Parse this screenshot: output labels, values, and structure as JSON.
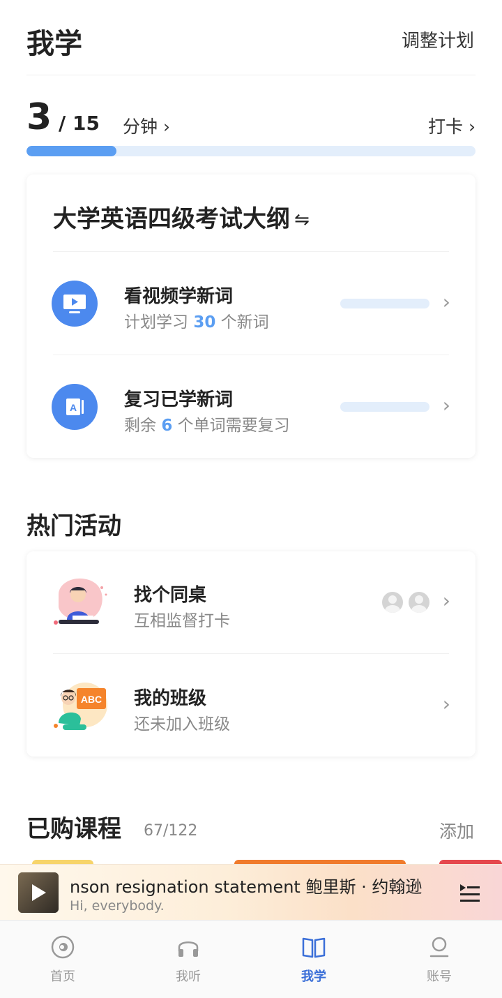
{
  "header": {
    "title": "我学",
    "action_label": "调整计划"
  },
  "progress": {
    "current": "3",
    "total": "/ 15",
    "unit": "分钟 ›",
    "checkin_label": "打卡 ›",
    "fraction": 0.2
  },
  "plan": {
    "title": "大学英语四级考试大纲",
    "swap_icon": "⇋",
    "rows": [
      {
        "title": "看视频学新词",
        "sub_prefix": "计划学习 ",
        "num": "30",
        "sub_suffix": " 个新词",
        "icon": "video-icon"
      },
      {
        "title": "复习已学新词",
        "sub_prefix": "剩余 ",
        "num": "6",
        "sub_suffix": " 个单词需要复习",
        "icon": "word-card-icon"
      }
    ]
  },
  "activities": {
    "title": "热门活动",
    "items": [
      {
        "title": "找个同桌",
        "sub": "互相监督打卡"
      },
      {
        "title": "我的班级",
        "sub": "还未加入班级"
      }
    ]
  },
  "courses": {
    "title": "已购课程",
    "count": "67/122",
    "add_label": "添加"
  },
  "player": {
    "title": "nson resignation statement   鲍里斯 · 约翰逊",
    "subtitle": "Hi, everybody."
  },
  "nav": [
    {
      "label": "首页",
      "icon": "home-icon"
    },
    {
      "label": "我听",
      "icon": "headphones-icon"
    },
    {
      "label": "我学",
      "icon": "book-icon",
      "active": true
    },
    {
      "label": "账号",
      "icon": "account-icon"
    }
  ],
  "colors": {
    "accent": "#4c89ee",
    "progress": "#5b9ef2",
    "track": "#e3eefb",
    "nav_active": "#3b6fd8"
  }
}
